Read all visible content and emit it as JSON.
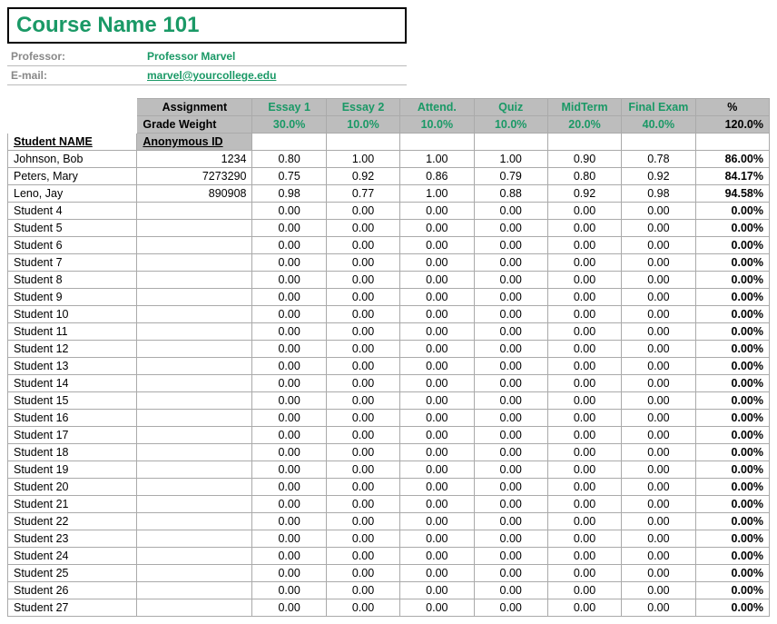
{
  "title": "Course Name 101",
  "meta": {
    "professor_label": "Professor:",
    "professor_value": "Professor Marvel",
    "email_label": "E-mail:",
    "email_value": "marvel@yourcollege.edu"
  },
  "headers": {
    "assignment_label": "Assignment",
    "grade_weight_label": "Grade Weight",
    "student_name_label": "Student NAME",
    "anon_id_label": "Anonymous ID",
    "percent_label": "%",
    "total_weight": "120.0%",
    "assignments": [
      {
        "name": "Essay 1",
        "weight": "30.0%"
      },
      {
        "name": "Essay 2",
        "weight": "10.0%"
      },
      {
        "name": "Attend.",
        "weight": "10.0%"
      },
      {
        "name": "Quiz",
        "weight": "10.0%"
      },
      {
        "name": "MidTerm",
        "weight": "20.0%"
      },
      {
        "name": "Final Exam",
        "weight": "40.0%"
      }
    ]
  },
  "students": [
    {
      "name": "Johnson, Bob",
      "id": "1234",
      "s": [
        "0.80",
        "1.00",
        "1.00",
        "1.00",
        "0.90",
        "0.78"
      ],
      "pct": "86.00%"
    },
    {
      "name": "Peters, Mary",
      "id": "7273290",
      "s": [
        "0.75",
        "0.92",
        "0.86",
        "0.79",
        "0.80",
        "0.92"
      ],
      "pct": "84.17%"
    },
    {
      "name": "Leno, Jay",
      "id": "890908",
      "s": [
        "0.98",
        "0.77",
        "1.00",
        "0.88",
        "0.92",
        "0.98"
      ],
      "pct": "94.58%"
    },
    {
      "name": "Student 4",
      "id": "",
      "s": [
        "0.00",
        "0.00",
        "0.00",
        "0.00",
        "0.00",
        "0.00"
      ],
      "pct": "0.00%"
    },
    {
      "name": "Student 5",
      "id": "",
      "s": [
        "0.00",
        "0.00",
        "0.00",
        "0.00",
        "0.00",
        "0.00"
      ],
      "pct": "0.00%"
    },
    {
      "name": "Student 6",
      "id": "",
      "s": [
        "0.00",
        "0.00",
        "0.00",
        "0.00",
        "0.00",
        "0.00"
      ],
      "pct": "0.00%"
    },
    {
      "name": "Student 7",
      "id": "",
      "s": [
        "0.00",
        "0.00",
        "0.00",
        "0.00",
        "0.00",
        "0.00"
      ],
      "pct": "0.00%"
    },
    {
      "name": "Student 8",
      "id": "",
      "s": [
        "0.00",
        "0.00",
        "0.00",
        "0.00",
        "0.00",
        "0.00"
      ],
      "pct": "0.00%"
    },
    {
      "name": "Student 9",
      "id": "",
      "s": [
        "0.00",
        "0.00",
        "0.00",
        "0.00",
        "0.00",
        "0.00"
      ],
      "pct": "0.00%"
    },
    {
      "name": "Student 10",
      "id": "",
      "s": [
        "0.00",
        "0.00",
        "0.00",
        "0.00",
        "0.00",
        "0.00"
      ],
      "pct": "0.00%"
    },
    {
      "name": "Student 11",
      "id": "",
      "s": [
        "0.00",
        "0.00",
        "0.00",
        "0.00",
        "0.00",
        "0.00"
      ],
      "pct": "0.00%"
    },
    {
      "name": "Student 12",
      "id": "",
      "s": [
        "0.00",
        "0.00",
        "0.00",
        "0.00",
        "0.00",
        "0.00"
      ],
      "pct": "0.00%"
    },
    {
      "name": "Student 13",
      "id": "",
      "s": [
        "0.00",
        "0.00",
        "0.00",
        "0.00",
        "0.00",
        "0.00"
      ],
      "pct": "0.00%"
    },
    {
      "name": "Student 14",
      "id": "",
      "s": [
        "0.00",
        "0.00",
        "0.00",
        "0.00",
        "0.00",
        "0.00"
      ],
      "pct": "0.00%"
    },
    {
      "name": "Student 15",
      "id": "",
      "s": [
        "0.00",
        "0.00",
        "0.00",
        "0.00",
        "0.00",
        "0.00"
      ],
      "pct": "0.00%"
    },
    {
      "name": "Student 16",
      "id": "",
      "s": [
        "0.00",
        "0.00",
        "0.00",
        "0.00",
        "0.00",
        "0.00"
      ],
      "pct": "0.00%"
    },
    {
      "name": "Student 17",
      "id": "",
      "s": [
        "0.00",
        "0.00",
        "0.00",
        "0.00",
        "0.00",
        "0.00"
      ],
      "pct": "0.00%"
    },
    {
      "name": "Student 18",
      "id": "",
      "s": [
        "0.00",
        "0.00",
        "0.00",
        "0.00",
        "0.00",
        "0.00"
      ],
      "pct": "0.00%"
    },
    {
      "name": "Student 19",
      "id": "",
      "s": [
        "0.00",
        "0.00",
        "0.00",
        "0.00",
        "0.00",
        "0.00"
      ],
      "pct": "0.00%"
    },
    {
      "name": "Student 20",
      "id": "",
      "s": [
        "0.00",
        "0.00",
        "0.00",
        "0.00",
        "0.00",
        "0.00"
      ],
      "pct": "0.00%"
    },
    {
      "name": "Student 21",
      "id": "",
      "s": [
        "0.00",
        "0.00",
        "0.00",
        "0.00",
        "0.00",
        "0.00"
      ],
      "pct": "0.00%"
    },
    {
      "name": "Student 22",
      "id": "",
      "s": [
        "0.00",
        "0.00",
        "0.00",
        "0.00",
        "0.00",
        "0.00"
      ],
      "pct": "0.00%"
    },
    {
      "name": "Student 23",
      "id": "",
      "s": [
        "0.00",
        "0.00",
        "0.00",
        "0.00",
        "0.00",
        "0.00"
      ],
      "pct": "0.00%"
    },
    {
      "name": "Student 24",
      "id": "",
      "s": [
        "0.00",
        "0.00",
        "0.00",
        "0.00",
        "0.00",
        "0.00"
      ],
      "pct": "0.00%"
    },
    {
      "name": "Student 25",
      "id": "",
      "s": [
        "0.00",
        "0.00",
        "0.00",
        "0.00",
        "0.00",
        "0.00"
      ],
      "pct": "0.00%"
    },
    {
      "name": "Student 26",
      "id": "",
      "s": [
        "0.00",
        "0.00",
        "0.00",
        "0.00",
        "0.00",
        "0.00"
      ],
      "pct": "0.00%"
    },
    {
      "name": "Student 27",
      "id": "",
      "s": [
        "0.00",
        "0.00",
        "0.00",
        "0.00",
        "0.00",
        "0.00"
      ],
      "pct": "0.00%"
    }
  ]
}
